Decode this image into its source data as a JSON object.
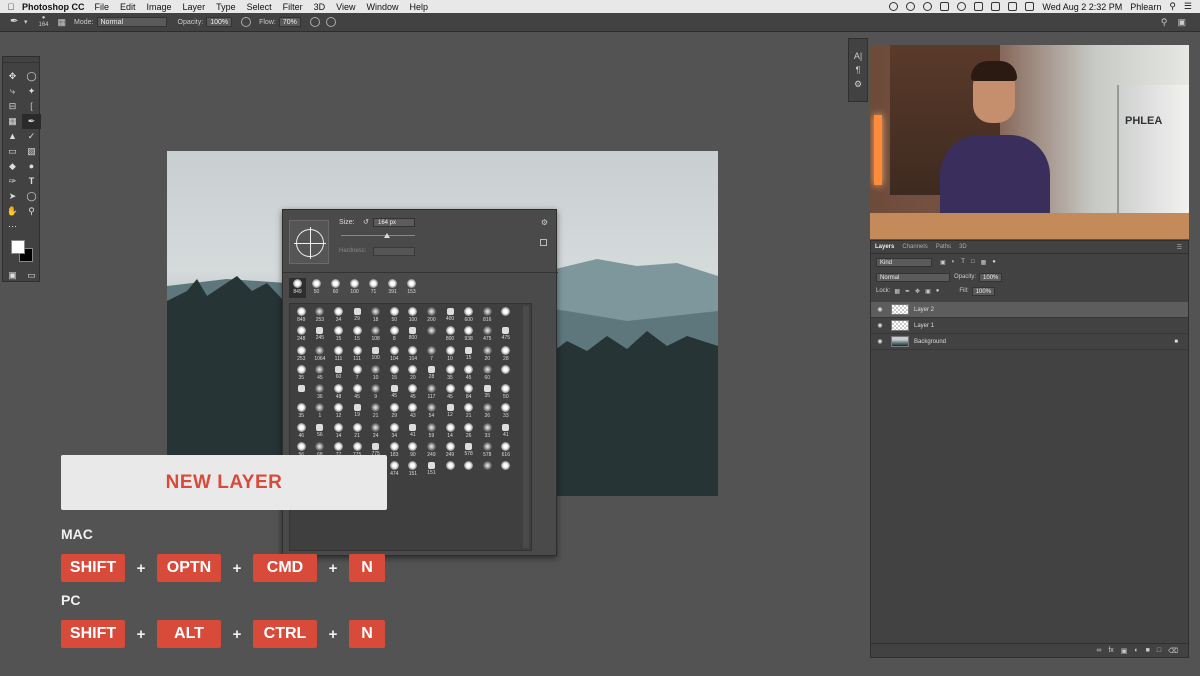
{
  "menubar": {
    "app": "Photoshop CC",
    "items": [
      "File",
      "Edit",
      "Image",
      "Layer",
      "Type",
      "Select",
      "Filter",
      "3D",
      "View",
      "Window",
      "Help"
    ],
    "datetime": "Wed Aug 2  2:32 PM",
    "user": "Phlearn"
  },
  "options": {
    "brush_size": "164",
    "mode_label": "Mode:",
    "mode_value": "Normal",
    "opacity_label": "Opacity:",
    "opacity_value": "100%",
    "flow_label": "Flow:",
    "flow_value": "70%"
  },
  "picker": {
    "size_label": "Size:",
    "size_value": "164 px",
    "hardness_label": "Hardness:",
    "recent": [
      "849",
      "50",
      "60",
      "100",
      "71",
      "391",
      "153"
    ],
    "grid": [
      "849",
      "253",
      "34",
      "29",
      "18",
      "50",
      "100",
      "200",
      "400",
      "600",
      "816",
      "",
      "248",
      "245",
      "15",
      "15",
      "108",
      "8",
      "800",
      "",
      "800",
      "938",
      "475",
      "475",
      "253",
      "1064",
      "111",
      "111",
      "100",
      "104",
      "104",
      "7",
      "10",
      "15",
      "20",
      "28",
      "35",
      "45",
      "60",
      "7",
      "10",
      "15",
      "20",
      "28",
      "35",
      "45",
      "60",
      "",
      "",
      "36",
      "48",
      "45",
      "9",
      "45",
      "45",
      "117",
      "45",
      "84",
      "35",
      "50",
      "35",
      "1",
      "12",
      "19",
      "21",
      "29",
      "43",
      "54",
      "12",
      "21",
      "26",
      "33",
      "46",
      "56",
      "14",
      "21",
      "24",
      "34",
      "41",
      "59",
      "14",
      "26",
      "33",
      "41",
      "56",
      "68",
      "77",
      "775",
      "775",
      "183",
      "90",
      "249",
      "249",
      "578",
      "578",
      "616",
      "",
      "",
      "",
      "",
      "",
      "474",
      "151",
      "151",
      "",
      "",
      "",
      ""
    ]
  },
  "overlay": {
    "title": "NEW LAYER",
    "mac_label": "MAC",
    "pc_label": "PC",
    "mac_keys": [
      "SHIFT",
      "OPTN",
      "CMD",
      "N"
    ],
    "pc_keys": [
      "SHIFT",
      "ALT",
      "CTRL",
      "N"
    ],
    "plus": "+"
  },
  "layers": {
    "tabs": [
      "Layers",
      "Channels",
      "Paths",
      "3D"
    ],
    "kind": "Kind",
    "blend": "Normal",
    "opacity_label": "Opacity:",
    "opacity_value": "100%",
    "lock_label": "Lock:",
    "fill_label": "Fill:",
    "fill_value": "100%",
    "items": [
      "Layer 2",
      "Layer 1",
      "Background"
    ]
  },
  "video": {
    "shirt_logo": "PHLEA"
  }
}
